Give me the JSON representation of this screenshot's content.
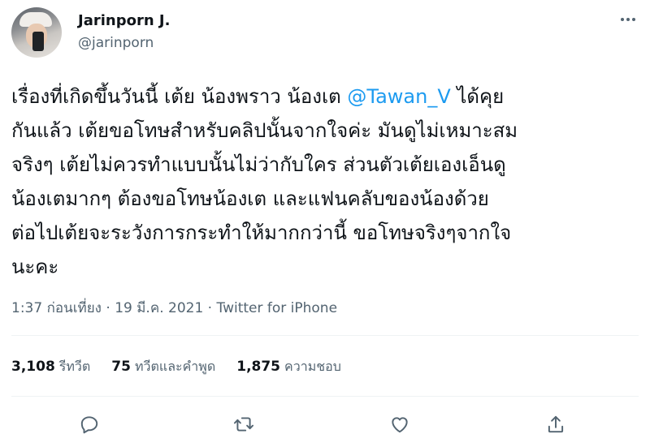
{
  "user": {
    "display_name": "Jarinporn J.",
    "handle": "@jarinporn"
  },
  "tweet": {
    "lines": [
      {
        "before": "เรื่องที่เกิดขึ้นวันนี้ เต้ย น้องพราว น้องเต ",
        "mention": "@Tawan_V",
        "after": " ได้คุย"
      },
      {
        "text": "กันแล้ว เต้ยขอโทษสำหรับคลิปนั้นจากใจค่ะ มันดูไม่เหมาะสม"
      },
      {
        "text": "จริงๆ เต้ยไม่ควรทำแบบนั้นไม่ว่ากับใคร ส่วนตัวเต้ยเองเอ็นดู"
      },
      {
        "text": "น้องเตมากๆ ต้องขอโทษน้องเต และแฟนคลับของน้องด้วย"
      },
      {
        "text": "ต่อไปเต้ยจะระวังการกระทำให้มากกว่านี้ ขอโทษจริงๆจากใจ"
      },
      {
        "text": "นะคะ"
      }
    ],
    "meta": "1:37 ก่อนเที่ยง · 19 มี.ค. 2021 · Twitter for iPhone"
  },
  "stats": {
    "retweets": {
      "count": "3,108",
      "label": "รีทวีต"
    },
    "quotes": {
      "count": "75",
      "label": "ทวีตและคำพูด"
    },
    "likes": {
      "count": "1,875",
      "label": "ความชอบ"
    }
  },
  "actions": {
    "reply_icon": "reply-icon",
    "retweet_icon": "retweet-icon",
    "like_icon": "heart-icon",
    "share_icon": "share-icon",
    "icon_color": "#536471"
  },
  "colors": {
    "mention": "#1d9bf0",
    "text": "#0f1419",
    "secondary": "#536471",
    "divider": "#eff3f4"
  }
}
